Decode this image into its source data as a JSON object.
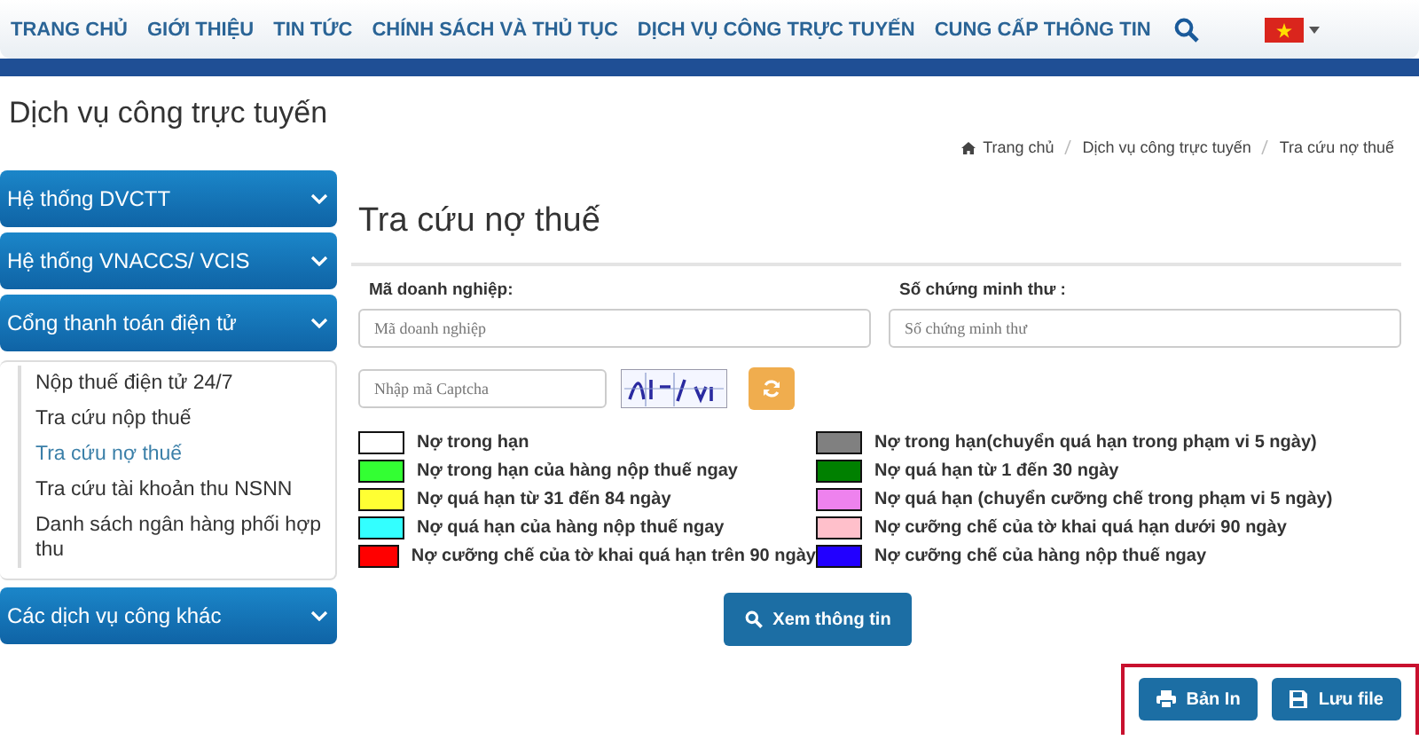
{
  "nav": {
    "items": [
      {
        "label": "TRANG CHỦ"
      },
      {
        "label": "GIỚI THIỆU"
      },
      {
        "label": "TIN TỨC"
      },
      {
        "label": "CHÍNH SÁCH VÀ THỦ TỤC"
      },
      {
        "label": "DỊCH VỤ CÔNG TRỰC TUYẾN"
      },
      {
        "label": "CUNG CẤP THÔNG TIN"
      }
    ]
  },
  "page_title": "Dịch vụ công trực tuyến",
  "breadcrumb": [
    "Trang chủ",
    "Dịch vụ công trực tuyến",
    "Tra cứu nợ thuế"
  ],
  "sidebar": {
    "groups": [
      {
        "label": "Hệ thống DVCTT"
      },
      {
        "label": "Hệ thống VNACCS/ VCIS"
      },
      {
        "label": "Cổng thanh toán điện tử",
        "children": [
          {
            "label": "Nộp thuế điện tử 24/7",
            "selected": false
          },
          {
            "label": "Tra cứu nộp thuế",
            "selected": false
          },
          {
            "label": "Tra cứu nợ thuế",
            "selected": true
          },
          {
            "label": "Tra cứu tài khoản thu NSNN",
            "selected": false
          },
          {
            "label": "Danh sách ngân hàng phối hợp thu",
            "selected": false
          }
        ]
      },
      {
        "label": "Các dịch vụ công khác"
      }
    ]
  },
  "form": {
    "title": "Tra cứu nợ thuế",
    "fields": [
      {
        "label": "Mã doanh nghiệp:",
        "placeholder": "Mã doanh nghiệp"
      },
      {
        "label": "Số chứng minh thư :",
        "placeholder": "Số chứng minh thư"
      }
    ],
    "captcha": {
      "placeholder": "Nhập mã Captcha"
    },
    "legend": [
      {
        "label": "Nợ trong hạn",
        "color": "#ffffff"
      },
      {
        "label": "Nợ trong hạn(chuyển quá hạn trong phạm vi 5 ngày)",
        "color": "#808080"
      },
      {
        "label": "Nợ trong hạn của hàng nộp thuế ngay",
        "color": "#33ff33"
      },
      {
        "label": "Nợ quá hạn từ 1 đến 30 ngày",
        "color": "#008000"
      },
      {
        "label": "Nợ quá hạn từ 31 đến 84 ngày",
        "color": "#ffff33"
      },
      {
        "label": "Nợ quá hạn (chuyển cưỡng chế trong phạm vi 5 ngày)",
        "color": "#ee82ee"
      },
      {
        "label": "Nợ quá hạn của hàng nộp thuế ngay",
        "color": "#33ffff"
      },
      {
        "label": "Nợ cưỡng chế của tờ khai quá hạn dưới 90 ngày",
        "color": "#ffc0cb"
      },
      {
        "label": "Nợ cưỡng chế của tờ khai quá hạn trên 90 ngày",
        "color": "#ff0000"
      },
      {
        "label": "Nợ cưỡng chế của hàng nộp thuế ngay",
        "color": "#2200ff"
      }
    ],
    "submit": "Xem thông tin",
    "actions": [
      {
        "label": "Bản In",
        "kind": "print"
      },
      {
        "label": "Lưu file",
        "kind": "save"
      }
    ]
  }
}
